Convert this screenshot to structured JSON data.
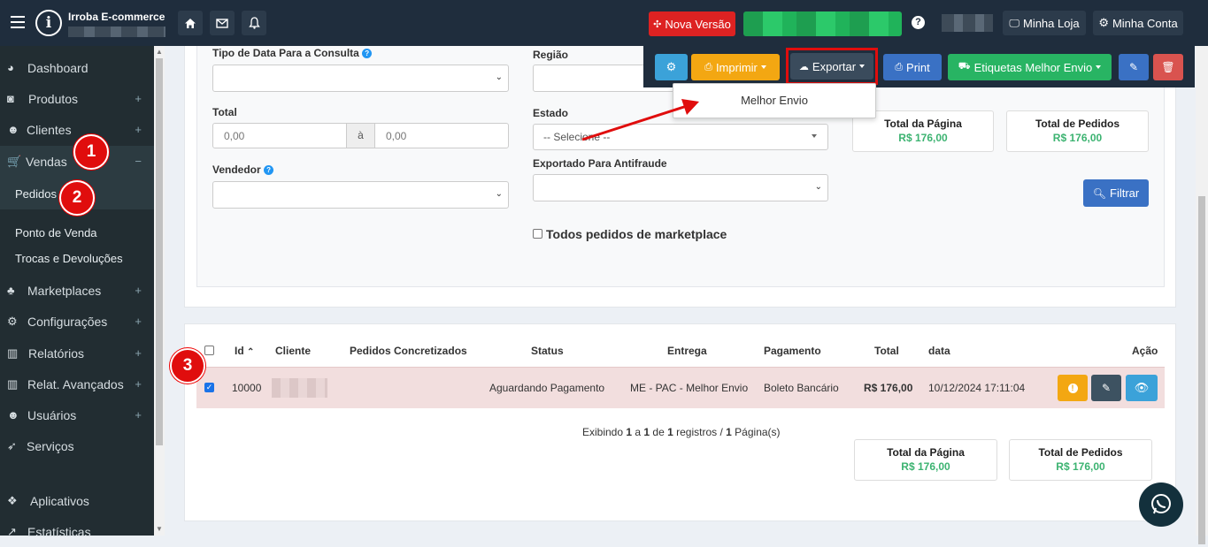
{
  "topbar": {
    "brand": "Irroba E-commerce",
    "nova_versao": "Nova Versão",
    "minha_loja": "Minha Loja",
    "minha_conta": "Minha Conta",
    "help": "?"
  },
  "sidebar": {
    "items": [
      {
        "label": "Dashboard",
        "icon": "dashboard-icon"
      },
      {
        "label": "Produtos",
        "icon": "camera-icon"
      },
      {
        "label": "Clientes",
        "icon": "users-icon"
      },
      {
        "label": "Vendas",
        "icon": "cart-icon"
      },
      {
        "label": "Marketplaces",
        "icon": "sitemap-icon"
      },
      {
        "label": "Configurações",
        "icon": "gears-icon"
      },
      {
        "label": "Relatórios",
        "icon": "bar-chart-icon"
      },
      {
        "label": "Relat. Avançados",
        "icon": "bar-chart-icon"
      },
      {
        "label": "Usuários",
        "icon": "users-icon"
      },
      {
        "label": "Serviços",
        "icon": "rocket-icon"
      },
      {
        "label": "Aplicativos",
        "icon": "cubes-icon"
      },
      {
        "label": "Estatísticas",
        "icon": "line-chart-icon"
      }
    ],
    "sub": [
      "Pedidos",
      "Ponto de Venda",
      "Trocas e Devoluções"
    ],
    "plus": "+",
    "minus": "−"
  },
  "badges": [
    "1",
    "2",
    "3"
  ],
  "toolbar": {
    "imprimir": "Imprimir",
    "exportar": "Exportar",
    "print": "Print",
    "etiquetas": "Etiquetas Melhor Envio",
    "dropdown_item": "Melhor Envio"
  },
  "filters": {
    "tipo_data": "Tipo de Data Para a Consulta",
    "regiao": "Região",
    "total": "Total",
    "total_from": "0,00",
    "total_sep": "à",
    "total_to": "0,00",
    "estado": "Estado",
    "estado_value": "-- Selecione --",
    "vendedor": "Vendedor",
    "antifraude": "Exportado Para Antifraude",
    "marketplace": "Todos pedidos de marketplace",
    "filtrar": "Filtrar"
  },
  "totals_top": {
    "pagina_label": "Total da Página",
    "pagina_value": "R$ 176,00",
    "pedidos_label": "Total de Pedidos",
    "pedidos_value": "R$ 176,00"
  },
  "table": {
    "headers": [
      "Id",
      "Cliente",
      "Pedidos Concretizados",
      "Status",
      "Entrega",
      "Pagamento",
      "Total",
      "data",
      "Ação"
    ],
    "row": {
      "id": "10000",
      "status": "Aguardando Pagamento",
      "entrega": "ME - PAC - Melhor Envio",
      "pagamento": "Boleto Bancário",
      "total": "R$ 176,00",
      "data": "10/12/2024 17:11:04"
    },
    "footer_prefix": "Exibindo ",
    "footer_a": "1",
    "footer_mid1": " a ",
    "footer_b": "1",
    "footer_mid2": " de ",
    "footer_c": "1",
    "footer_mid3": " registros / ",
    "footer_d": "1",
    "footer_suffix": " Página(s)"
  },
  "totals_bottom": {
    "pagina_label": "Total da Página",
    "pagina_value": "R$ 176,00",
    "pedidos_label": "Total de Pedidos",
    "pedidos_value": "R$ 176,00"
  },
  "colors": {
    "topbar": "#1f2d3d",
    "sidebar": "#222d32",
    "red": "#dd2222",
    "green": "#28b463",
    "blue": "#3c8dbc",
    "orange": "#f39c12",
    "row_highlight": "#f2dede"
  }
}
